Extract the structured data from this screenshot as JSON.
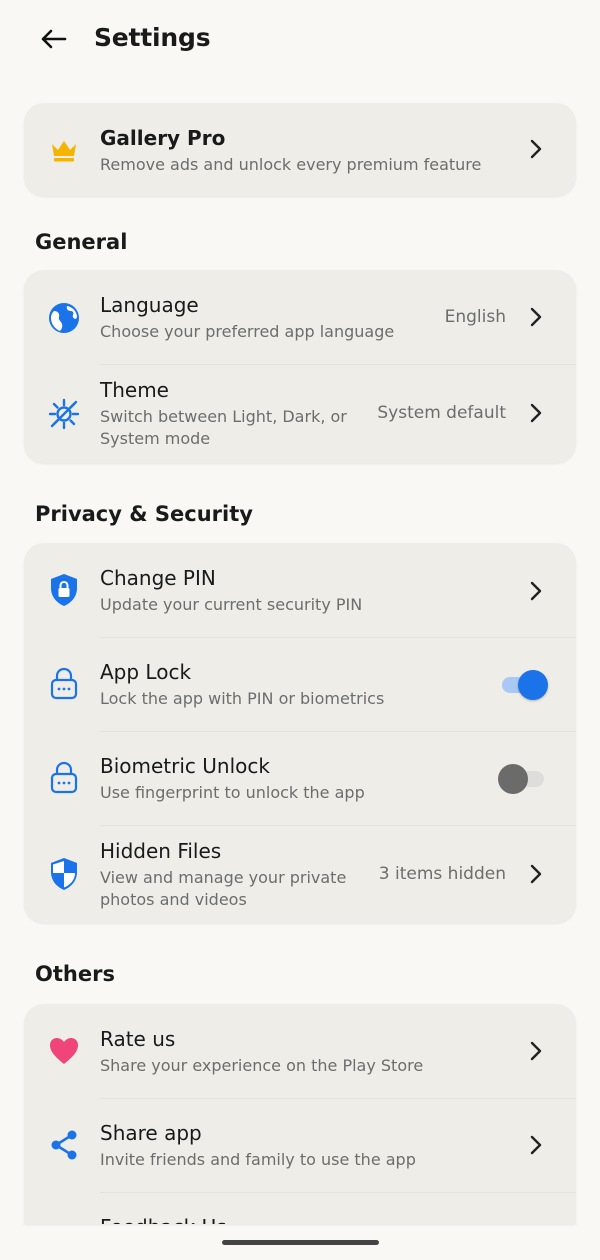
{
  "header": {
    "title": "Settings",
    "back_icon": "arrow-left-icon"
  },
  "pro": {
    "title": "Gallery Pro",
    "subtitle": "Remove ads and unlock every premium feature",
    "icon": "crown-icon",
    "icon_color": "#f5b400"
  },
  "sections": {
    "general": {
      "title": "General",
      "items": [
        {
          "title": "Language",
          "subtitle": "Choose your preferred app language",
          "value": "English",
          "icon": "globe-icon"
        },
        {
          "title": "Theme",
          "subtitle_line1": "Switch between Light, Dark, or",
          "subtitle_line2": "System mode",
          "value": "System default",
          "icon": "theme-icon"
        }
      ]
    },
    "privacy": {
      "title": "Privacy & Security",
      "items": [
        {
          "title": "Change PIN",
          "subtitle": "Update your current security PIN",
          "icon": "shield-lock-icon"
        },
        {
          "title": "App Lock",
          "subtitle": "Lock the app with PIN or biometrics",
          "icon": "padlock-icon",
          "toggle": true
        },
        {
          "title": "Biometric Unlock",
          "subtitle": "Use fingerprint to unlock the app",
          "icon": "padlock-icon",
          "toggle": false
        },
        {
          "title": "Hidden Files",
          "subtitle_line1": "View and manage your private",
          "subtitle_line2": "photos and videos",
          "value": "3 items hidden",
          "icon": "shield-icon"
        }
      ]
    },
    "others": {
      "title": "Others",
      "items": [
        {
          "title": "Rate us",
          "subtitle": "Share your experience on the Play Store",
          "icon": "heart-icon"
        },
        {
          "title": "Share app",
          "subtitle": "Invite friends and family to use the app",
          "icon": "share-icon"
        },
        {
          "title": "Feedback Us",
          "icon": "feedback-icon"
        }
      ]
    }
  },
  "colors": {
    "accent": "#1a73e8",
    "heart": "#f0457a",
    "crown": "#f5b400",
    "background": "#f9f8f5",
    "card": "#eeede7"
  }
}
